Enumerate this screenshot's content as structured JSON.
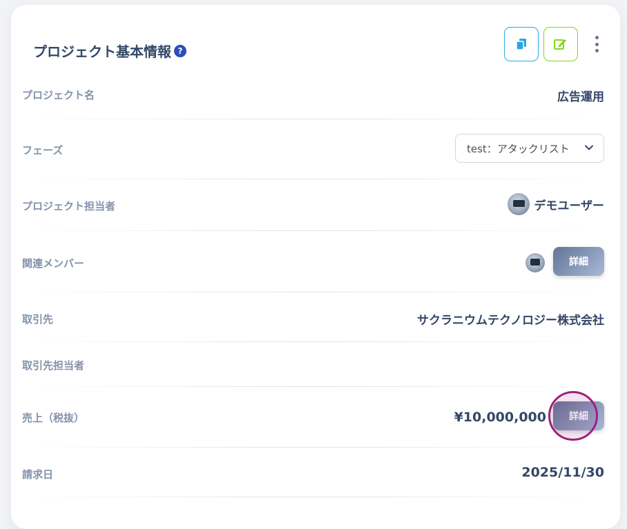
{
  "header": {
    "title": "プロジェクト基本情報",
    "help_icon": "question-circle-icon",
    "copy_icon": "copy-icon",
    "edit_icon": "edit-icon",
    "menu_icon": "kebab-menu-icon",
    "colors": {
      "copy": "#2aa7e0",
      "edit": "#82d616"
    }
  },
  "fields": {
    "project_name": {
      "label": "プロジェクト名",
      "value": "広告運用"
    },
    "phase": {
      "label": "フェーズ",
      "selected": "test：アタックリスト"
    },
    "owner": {
      "label": "プロジェクト担当者",
      "value": "デモユーザー"
    },
    "members": {
      "label": "関連メンバー",
      "detail_label": "詳細"
    },
    "client": {
      "label": "取引先",
      "value": "サクラニウムテクノロジー株式会社"
    },
    "client_contact": {
      "label": "取引先担当者",
      "value": ""
    },
    "sales": {
      "label": "売上（税抜）",
      "value": "¥10,000,000",
      "detail_label": "詳細"
    },
    "invoice_date": {
      "label": "請求日",
      "value": "2025/11/30"
    }
  }
}
